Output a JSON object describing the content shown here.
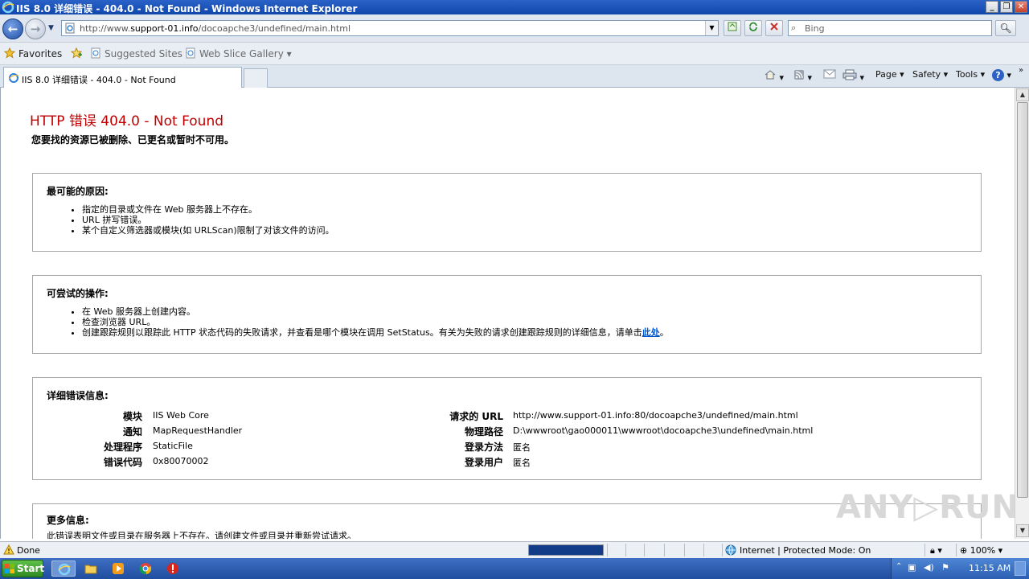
{
  "window": {
    "title": "IIS 8.0 详细错误 - 404.0 - Not Found - Windows Internet Explorer",
    "minimize": "_",
    "restore": "❐",
    "close": "✕"
  },
  "navigation": {
    "back_glyph": "←",
    "forward_glyph": "→",
    "dropdown": "▼",
    "url_prefix": "http://www.",
    "url_host": "support-01.info",
    "url_path": "/docoapche3/undefined/main.html",
    "search_placeholder": "Bing"
  },
  "favorites_bar": {
    "favorites": "Favorites",
    "suggested": "Suggested Sites",
    "gallery": "Web Slice Gallery",
    "caret": "▾"
  },
  "tab": {
    "title": "IIS 8.0 详细错误 - 404.0 - Not Found"
  },
  "command_bar": {
    "page": "Page ▾",
    "safety": "Safety ▾",
    "tools": "Tools ▾",
    "help": "?"
  },
  "page": {
    "heading": "HTTP 错误 404.0 - Not Found",
    "subheading": "您要找的资源已被删除、已更名或暂时不可用。",
    "causes_title": "最可能的原因:",
    "causes": [
      "指定的目录或文件在 Web 服务器上不存在。",
      "URL 拼写错误。",
      "某个自定义筛选器或模块(如 URLScan)限制了对该文件的访问。"
    ],
    "actions_title": "可尝试的操作:",
    "actions": [
      "在 Web 服务器上创建内容。",
      "检查浏览器 URL。",
      "创建跟踪规则以跟踪此 HTTP 状态代码的失败请求，并查看是哪个模块在调用 SetStatus。有关为失败的请求创建跟踪规则的详细信息，请单击"
    ],
    "actions_link": "此处",
    "actions_tail": "。",
    "details_title": "详细错误信息:",
    "details_left": [
      {
        "label": "模块",
        "value": "IIS Web Core"
      },
      {
        "label": "通知",
        "value": "MapRequestHandler"
      },
      {
        "label": "处理程序",
        "value": "StaticFile"
      },
      {
        "label": "错误代码",
        "value": "0x80070002"
      }
    ],
    "details_right": [
      {
        "label": "请求的 URL",
        "value": "http://www.support-01.info:80/docoapche3/undefined/main.html"
      },
      {
        "label": "物理路径",
        "value": "D:\\wwwroot\\gao000011\\wwwroot\\docoapche3\\undefined\\main.html"
      },
      {
        "label": "登录方法",
        "value": "匿名"
      },
      {
        "label": "登录用户",
        "value": "匿名"
      }
    ],
    "more_title": "更多信息:",
    "more_text": "此错误表明文件或目录在服务器上不存在。请创建文件或目录并重新尝试请求。"
  },
  "watermark": "ANY▷RUN",
  "status": {
    "text": "Done",
    "zone": "Internet | Protected Mode: On",
    "zoom": "100%",
    "progress": 1.0
  },
  "taskbar": {
    "start": "Start",
    "clock": "11:15 AM"
  },
  "colors": {
    "error_heading": "#c00000",
    "link": "#0055cc"
  }
}
